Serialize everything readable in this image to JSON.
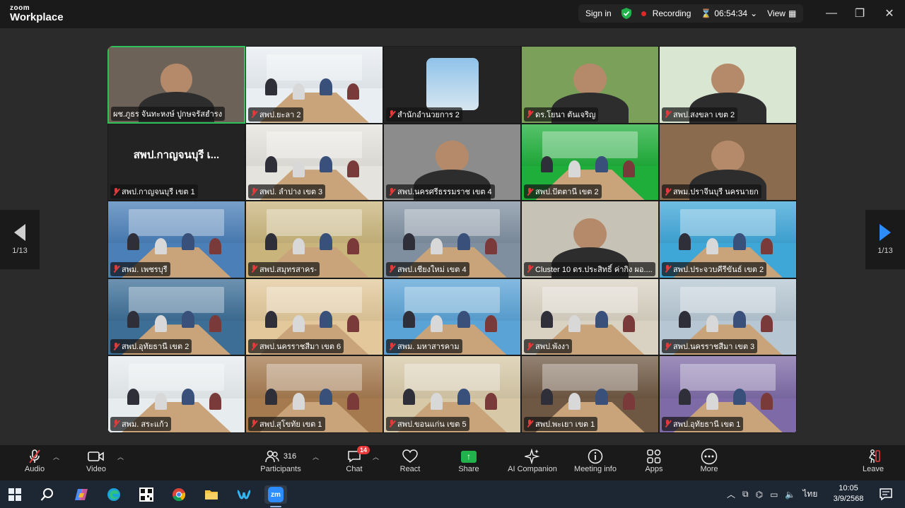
{
  "titlebar": {
    "brand_top": "zoom",
    "brand_bottom": "Workplace",
    "sign_in": "Sign in",
    "recording": "Recording",
    "timer": "06:54:34",
    "view": "View"
  },
  "pagination": {
    "left": "1/13",
    "right": "1/13"
  },
  "participants": [
    {
      "name": "ผช.ภูธร จันทะหงษ์ ปูกษจรัสฮำรง",
      "muted": false,
      "active": true,
      "scene": "face",
      "bg": "#6d6257"
    },
    {
      "name": "สพป.ยะลา 2",
      "muted": true,
      "scene": "room",
      "bg": "#e9eef2"
    },
    {
      "name": "สำนักอำนวยการ 2",
      "muted": true,
      "scene": "photo",
      "bg": "#242424"
    },
    {
      "name": "ดร.โยนา ตันเจริญ",
      "muted": true,
      "scene": "face",
      "bg": "#7aa05a"
    },
    {
      "name": "สพป.สงขลา เขต 2",
      "muted": true,
      "scene": "face",
      "bg": "#d8e6d2"
    },
    {
      "name": "สพป.กาญจนบุรี เขต 1",
      "muted": true,
      "scene": "name",
      "display": "สพป.กาญจนบุรี เ...",
      "bg": "#232323"
    },
    {
      "name": "สพป. ลำปาง เขต 3",
      "muted": true,
      "scene": "room",
      "bg": "#e5e3dd"
    },
    {
      "name": "สพป.นครศรีธรรมราช เขต 4",
      "muted": true,
      "scene": "face",
      "bg": "#8c8c8c"
    },
    {
      "name": "สพป.ปัตตานี เขต 2",
      "muted": true,
      "scene": "room",
      "bg": "#1fae3a"
    },
    {
      "name": "สพม.ปราจีนบุรี นครนายก",
      "muted": true,
      "scene": "face",
      "bg": "#8a6b4e"
    },
    {
      "name": "สพม. เพชรบุรี",
      "muted": true,
      "scene": "room",
      "bg": "#4a7fb8"
    },
    {
      "name": "สพป.สมุทรสาคร-",
      "muted": true,
      "scene": "room",
      "bg": "#c9b57c"
    },
    {
      "name": "สพป.เชียงใหม่ เขต 4",
      "muted": true,
      "scene": "room",
      "bg": "#7f8fa0"
    },
    {
      "name": "Cluster 10 ดร.ประสิทธิ์ ค่ากิง ผอ....",
      "muted": true,
      "scene": "face",
      "bg": "#c7c2b6"
    },
    {
      "name": "สพป.ประจวบคีรีขันธ์ เขต 2",
      "muted": true,
      "scene": "room",
      "bg": "#3fa6d8"
    },
    {
      "name": "สพป.อุทัยธานี เขต 2",
      "muted": true,
      "scene": "room",
      "bg": "#3d6e96"
    },
    {
      "name": "สพป.นครราชสีมา เขต 6",
      "muted": true,
      "scene": "room",
      "bg": "#e2c89a"
    },
    {
      "name": "สพม. มหาสารคาม",
      "muted": true,
      "scene": "room",
      "bg": "#5aa3d6"
    },
    {
      "name": "สพป.พังงา",
      "muted": true,
      "scene": "room",
      "bg": "#d9d2c3"
    },
    {
      "name": "สพป.นครราชสีมา เขต 3",
      "muted": true,
      "scene": "room",
      "bg": "#b6c7d3"
    },
    {
      "name": "สพม. สระแก้ว",
      "muted": true,
      "scene": "room",
      "bg": "#e7ecef"
    },
    {
      "name": "สพป.สุโขทัย เขต 1",
      "muted": true,
      "scene": "room",
      "bg": "#a57a4f"
    },
    {
      "name": "สพป.ขอนแก่น เขต 5",
      "muted": true,
      "scene": "room",
      "bg": "#d7c9a8"
    },
    {
      "name": "สพป.พะเยา เขต 1",
      "muted": true,
      "scene": "room",
      "bg": "#6f5843"
    },
    {
      "name": "สพป.อุทัยธานี เขต 1",
      "muted": true,
      "scene": "room",
      "bg": "#7d6aa6"
    }
  ],
  "toolbar": {
    "audio": "Audio",
    "video": "Video",
    "participants": "Participants",
    "participants_count": "316",
    "chat": "Chat",
    "chat_badge": "14",
    "react": "React",
    "share": "Share",
    "ai": "AI Companion",
    "meeting_info": "Meeting info",
    "apps": "Apps",
    "more": "More",
    "leave": "Leave"
  },
  "taskbar": {
    "lang": "ไทย",
    "time": "10:05",
    "date": "3/9/2568"
  },
  "colors": {
    "accent_blue": "#2d8cff",
    "active_border": "#2ec35a",
    "share_green": "#22b24c",
    "mute_red": "#e03a3a"
  }
}
